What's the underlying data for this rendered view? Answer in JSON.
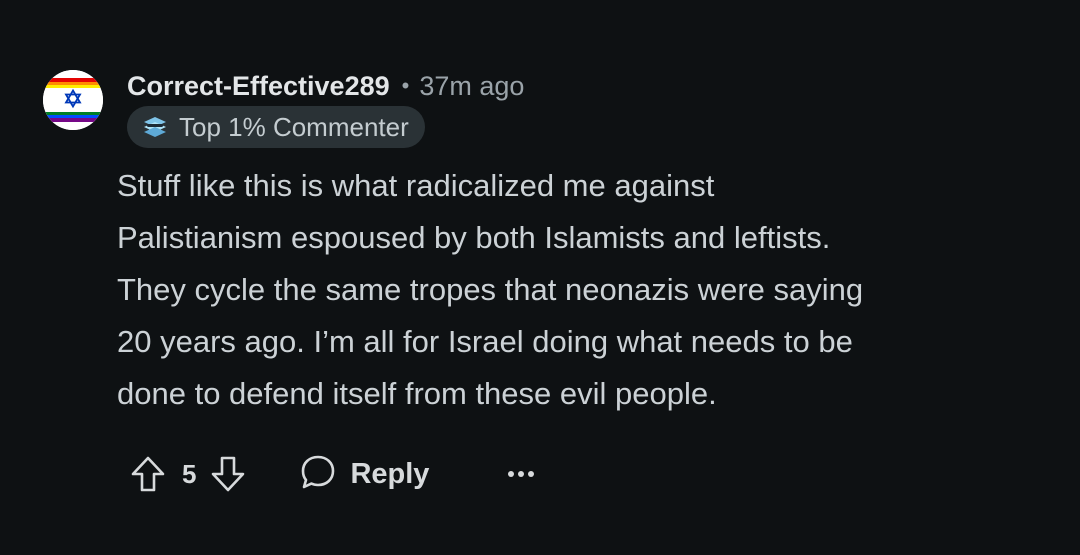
{
  "comment": {
    "username": "Correct-Effective289",
    "separator": "•",
    "time": "37m ago",
    "flair": {
      "label": "Top 1% Commenter",
      "icon": "top-commenter-badge-icon"
    },
    "avatar": {
      "icon": "star-of-david-rainbow-avatar"
    },
    "body_lines": [
      "Stuff like this is what radicalized me against",
      "Palistianism espoused by both Islamists and leftists.",
      "They cycle the same tropes that neonazis were saying",
      "20 years ago. I’m all for Israel doing what needs to be",
      "done to defend itself from these evil people."
    ],
    "actions": {
      "upvote_icon": "upvote-arrow-icon",
      "score": "5",
      "downvote_icon": "downvote-arrow-icon",
      "reply_icon": "speech-bubble-icon",
      "reply_label": "Reply",
      "more_icon": "ellipsis-icon"
    }
  },
  "colors": {
    "background": "#0e1113",
    "text_primary": "#d7dadc",
    "text_secondary": "#9aa3a9",
    "flair_background": "#2a3236",
    "flag_blue": "#0038b8"
  }
}
